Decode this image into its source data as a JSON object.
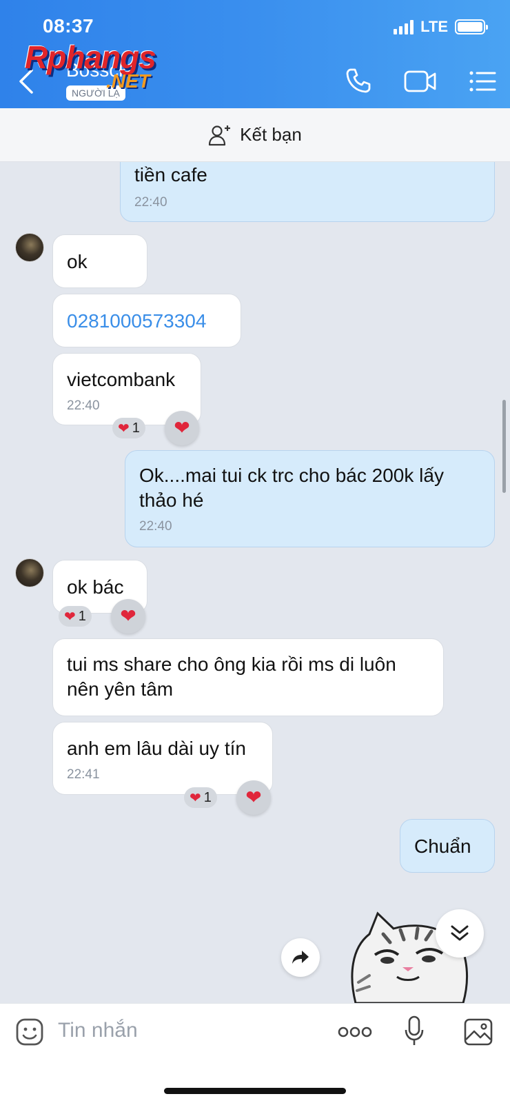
{
  "status_bar": {
    "time": "08:37",
    "network": "LTE"
  },
  "header": {
    "contact_name": "Bossck",
    "badge": "NGƯỜI LẠ",
    "watermark_main": "Rphangs",
    "watermark_sub": ".NET",
    "icons": [
      "back-icon",
      "phone-icon",
      "video-icon",
      "menu-icon"
    ],
    "colors": {
      "gradient_start": "#2f82ea",
      "gradient_end": "#4aa3f3"
    }
  },
  "friend_bar": {
    "label": "Kết bạn",
    "icon": "add-person-icon"
  },
  "messages": [
    {
      "side": "out",
      "text_partial": "tiền cafe",
      "time": "22:40"
    },
    {
      "side": "in",
      "text": "ok"
    },
    {
      "side": "in",
      "text": "0281000573304",
      "is_link": true
    },
    {
      "side": "in",
      "text": "vietcombank",
      "time": "22:40",
      "reaction_count": "1"
    },
    {
      "side": "out",
      "text": "Ok....mai tui ck trc cho bác 200k lấy thảo hé",
      "time": "22:40"
    },
    {
      "side": "in",
      "text": "ok bác",
      "reaction_count": "1"
    },
    {
      "side": "in",
      "text": "tui ms share cho ông kia rồi ms di luôn nên yên tâm"
    },
    {
      "side": "in",
      "text": "anh em lâu dài uy tín",
      "time": "22:41",
      "reaction_count": "1"
    },
    {
      "side": "out",
      "text": "Chuẩn"
    }
  ],
  "input_bar": {
    "placeholder": "Tin nhắn",
    "icons": [
      "sticker-icon",
      "more-icon",
      "microphone-icon",
      "image-icon"
    ]
  }
}
